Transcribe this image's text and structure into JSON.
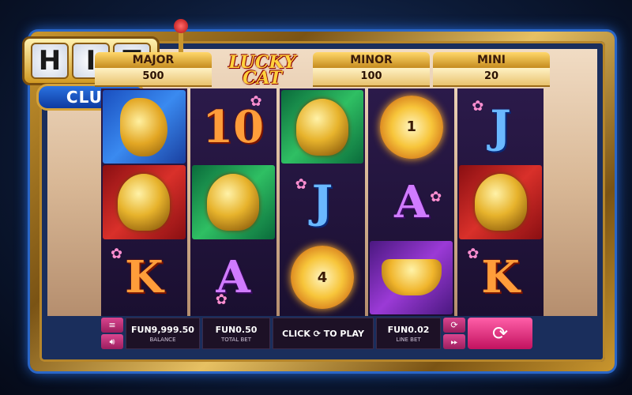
{
  "brand": {
    "hit_letters": [
      "H",
      "I",
      "T"
    ],
    "club_label": "CLUB"
  },
  "game": {
    "logo_line1": "LUCKY",
    "logo_line2": "CAT"
  },
  "jackpots": [
    {
      "label": "MAJOR",
      "value": "500"
    },
    {
      "label": "MINOR",
      "value": "100"
    },
    {
      "label": "MINI",
      "value": "20"
    }
  ],
  "reels": [
    [
      {
        "symbol": "golden-fish",
        "bg": "blue"
      },
      {
        "symbol": "lucky-cat",
        "bg": "red"
      },
      {
        "symbol": "K",
        "color": "red"
      }
    ],
    [
      {
        "symbol": "10",
        "color": "red"
      },
      {
        "symbol": "buddha",
        "bg": "green"
      },
      {
        "symbol": "A",
        "color": "purple"
      }
    ],
    [
      {
        "symbol": "buddha",
        "bg": "green"
      },
      {
        "symbol": "J",
        "color": "blue"
      },
      {
        "symbol": "coin",
        "value": "4"
      }
    ],
    [
      {
        "symbol": "coin",
        "value": "1"
      },
      {
        "symbol": "A",
        "color": "purple"
      },
      {
        "symbol": "gold-ingot",
        "bg": "purple"
      }
    ],
    [
      {
        "symbol": "J",
        "color": "blue"
      },
      {
        "symbol": "buddha",
        "bg": "red"
      },
      {
        "symbol": "K",
        "color": "red"
      }
    ]
  ],
  "bottom_bar": {
    "balance_value": "FUN9,999.50",
    "balance_label": "BALANCE",
    "total_bet_value": "FUN0.50",
    "total_bet_label": "TOTAL BET",
    "click_to_play": "CLICK ⟳ TO PLAY",
    "line_bet_value": "FUN0.02",
    "line_bet_label": "LINE BET"
  },
  "icons": [
    "menu-icon",
    "sound-icon",
    "autoplay-icon",
    "turbo-icon",
    "spin-icon"
  ]
}
